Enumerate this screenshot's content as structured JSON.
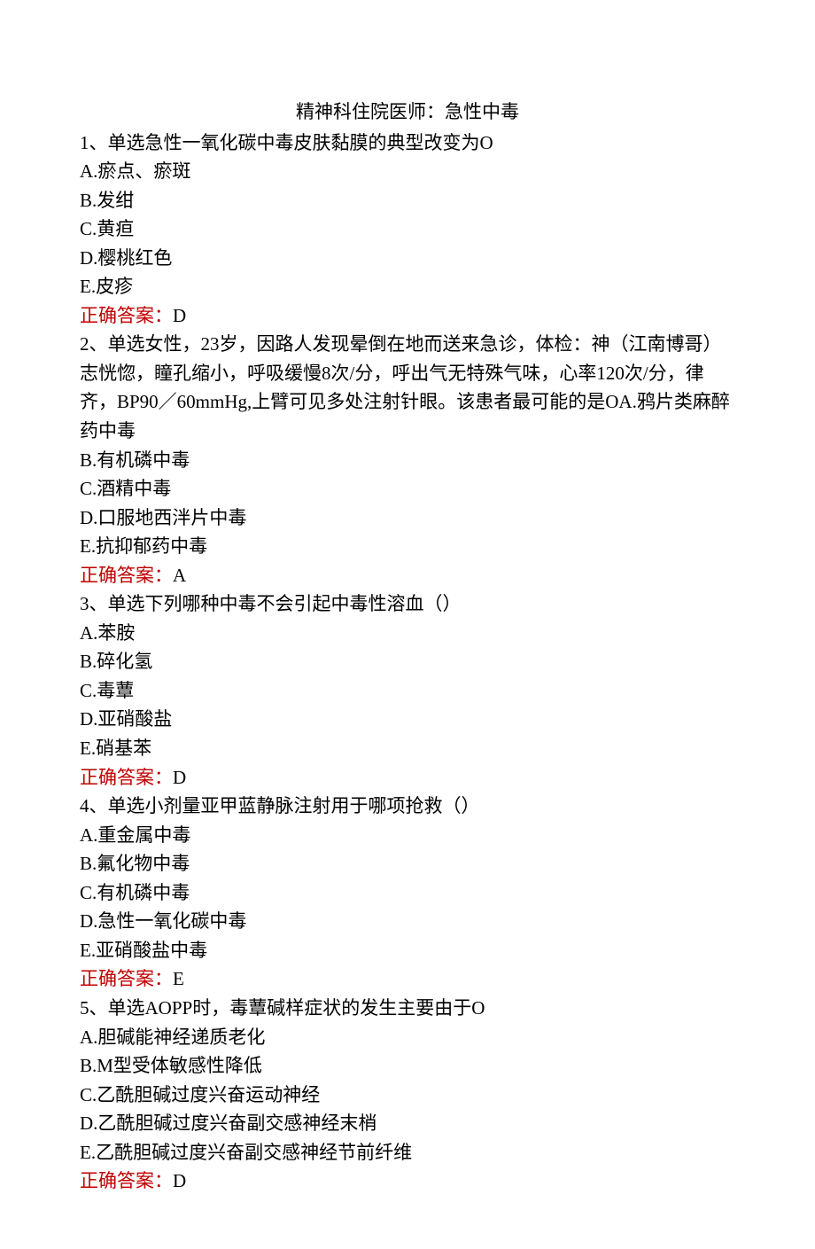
{
  "title": "精神科住院医师：急性中毒",
  "questions": [
    {
      "stem": "1、单选急性一氧化碳中毒皮肤黏膜的典型改变为O",
      "options": [
        "A.瘀点、瘀斑",
        "B.发绀",
        "C.黄疸",
        "D.樱桃红色",
        "E.皮疹"
      ],
      "answer_label": "正确答案：",
      "answer_value": "D"
    },
    {
      "stem": "2、单选女性，23岁，因路人发现晕倒在地而送来急诊，体检：神（江南博哥）志恍惚，瞳孔缩小，呼吸缓慢8次/分，呼出气无特殊气味，心率120次/分，律齐，BP90／60mmHg,上臂可见多处注射针眼。该患者最可能的是OA.鸦片类麻醉药中毒",
      "options": [
        "B.有机磷中毒",
        "C.酒精中毒",
        "D.口服地西泮片中毒",
        "E.抗抑郁药中毒"
      ],
      "answer_label": "正确答案：",
      "answer_value": "A"
    },
    {
      "stem": "3、单选下列哪种中毒不会引起中毒性溶血（）",
      "options": [
        "A.苯胺",
        "B.碎化氢",
        "C.毒蕈",
        "D.亚硝酸盐",
        "E.硝基苯"
      ],
      "answer_label": "正确答案：",
      "answer_value": "D"
    },
    {
      "stem": "4、单选小剂量亚甲蓝静脉注射用于哪项抢救（）",
      "options": [
        "A.重金属中毒",
        "B.氟化物中毒",
        "C.有机磷中毒",
        "D.急性一氧化碳中毒",
        "E.亚硝酸盐中毒"
      ],
      "answer_label": "正确答案：",
      "answer_value": "E"
    },
    {
      "stem": "5、单选AOPP时，毒蕈碱样症状的发生主要由于O",
      "options": [
        "A.胆碱能神经递质老化",
        "B.M型受体敏感性降低",
        "C.乙酰胆碱过度兴奋运动神经",
        "D.乙酰胆碱过度兴奋副交感神经末梢",
        "E.乙酰胆碱过度兴奋副交感神经节前纤维"
      ],
      "answer_label": "正确答案：",
      "answer_value": "D"
    }
  ]
}
